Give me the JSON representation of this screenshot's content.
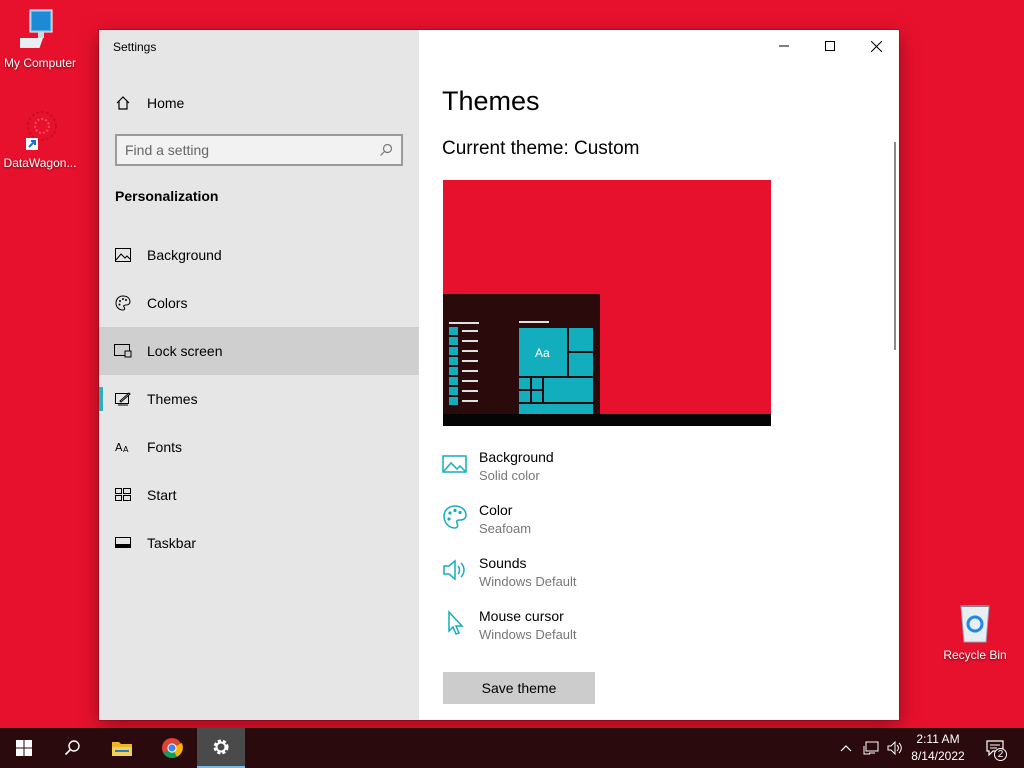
{
  "desktop": {
    "icons": [
      {
        "label": "My Computer"
      },
      {
        "label": "DataWagon..."
      },
      {
        "label": "Recycle Bin"
      }
    ]
  },
  "window": {
    "title": "Settings"
  },
  "sidebar": {
    "home_label": "Home",
    "search_placeholder": "Find a setting",
    "section_label": "Personalization",
    "items": [
      {
        "label": "Background",
        "icon": "picture-icon"
      },
      {
        "label": "Colors",
        "icon": "palette-icon"
      },
      {
        "label": "Lock screen",
        "icon": "lock-screen-icon"
      },
      {
        "label": "Themes",
        "icon": "brush-icon"
      },
      {
        "label": "Fonts",
        "icon": "fonts-icon"
      },
      {
        "label": "Start",
        "icon": "start-icon"
      },
      {
        "label": "Taskbar",
        "icon": "taskbar-icon"
      }
    ],
    "selected": "Themes",
    "hovered": "Lock screen"
  },
  "main": {
    "title": "Themes",
    "current_theme_label": "Current theme:",
    "current_theme_value": "Custom",
    "preview_tile_text": "Aa",
    "properties": [
      {
        "title": "Background",
        "value": "Solid color",
        "icon": "picture-icon"
      },
      {
        "title": "Color",
        "value": "Seafoam",
        "icon": "palette-icon"
      },
      {
        "title": "Sounds",
        "value": "Windows Default",
        "icon": "speaker-icon"
      },
      {
        "title": "Mouse cursor",
        "value": "Windows Default",
        "icon": "cursor-icon"
      }
    ],
    "save_button": "Save theme"
  },
  "taskbar": {
    "time": "2:11 AM",
    "date": "8/14/2022",
    "notification_count": "2"
  },
  "colors": {
    "desktop": "#e8112d",
    "accent": "#2bb0c0",
    "taskbar": "#2a0a0d"
  }
}
